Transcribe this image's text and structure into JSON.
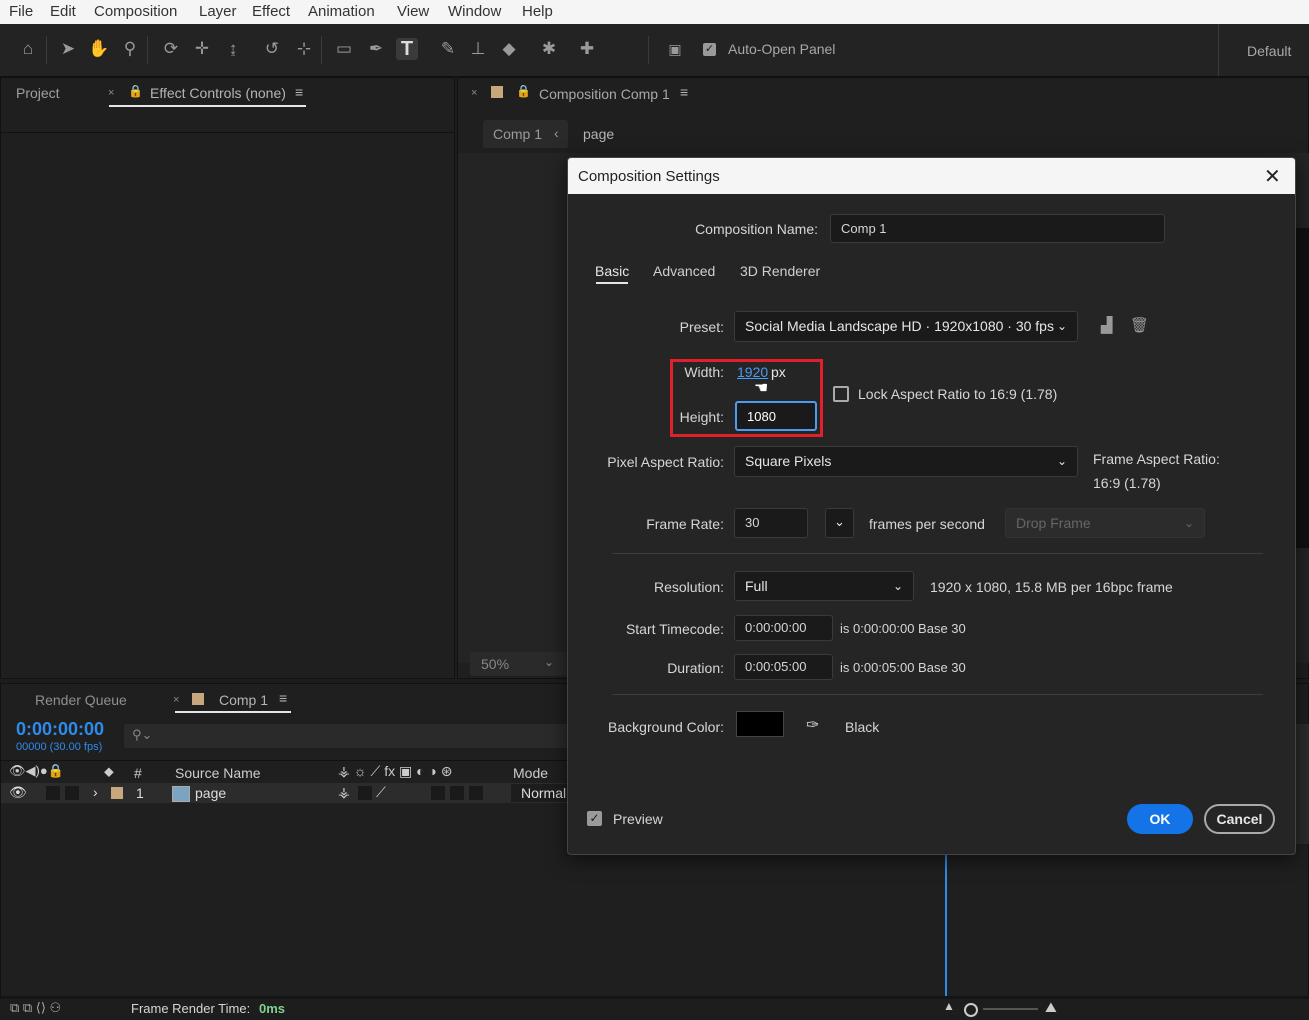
{
  "menu": [
    "File",
    "Edit",
    "Composition",
    "Layer",
    "Effect",
    "Animation",
    "View",
    "Window",
    "Help"
  ],
  "toolbar": {
    "auto_open_label": "Auto-Open Panel",
    "workspace": "Default"
  },
  "left_panel": {
    "tab_project": "Project",
    "tab_effect_controls": "Effect Controls (none)"
  },
  "comp_panel": {
    "tab_title": "Composition Comp 1",
    "breadcrumb_comp": "Comp 1",
    "breadcrumb_page": "page",
    "zoom": "50%"
  },
  "timeline": {
    "tab_render_queue": "Render Queue",
    "tab_comp": "Comp 1",
    "timecode": "0:00:00:00",
    "timecode_sub": "00000 (30.00 fps)",
    "col_number": "#",
    "col_source_name": "Source Name",
    "col_mode": "Mode",
    "layer": {
      "index": "1",
      "name": "page",
      "mode": "Normal"
    },
    "frame_render_label": "Frame Render Time:",
    "frame_render_value": "0ms"
  },
  "dialog": {
    "title": "Composition Settings",
    "comp_name_label": "Composition Name:",
    "comp_name_value": "Comp 1",
    "tabs": [
      "Basic",
      "Advanced",
      "3D Renderer"
    ],
    "preset_label": "Preset:",
    "preset_value": "Social Media Landscape HD · 1920x1080 · 30 fps",
    "width_label": "Width:",
    "width_value": "1920",
    "width_unit": "px",
    "height_label": "Height:",
    "height_value": "1080",
    "lock_aspect_label": "Lock Aspect Ratio to 16:9 (1.78)",
    "par_label": "Pixel Aspect Ratio:",
    "par_value": "Square Pixels",
    "frame_aspect_label": "Frame Aspect Ratio:",
    "frame_aspect_value": "16:9 (1.78)",
    "frame_rate_label": "Frame Rate:",
    "frame_rate_value": "30",
    "fps_label": "frames per second",
    "drop_frame": "Drop Frame",
    "resolution_label": "Resolution:",
    "resolution_value": "Full",
    "resolution_info": "1920 x 1080, 15.8 MB per 16bpc frame",
    "start_tc_label": "Start Timecode:",
    "start_tc_value": "0:00:00:00",
    "start_tc_info": "is 0:00:00:00  Base 30",
    "duration_label": "Duration:",
    "duration_value": "0:00:05:00",
    "duration_info": "is 0:00:05:00  Base 30",
    "bg_color_label": "Background Color:",
    "bg_color_name": "Black",
    "preview_label": "Preview",
    "ok_label": "OK",
    "cancel_label": "Cancel"
  },
  "colors": {
    "accent_blue": "#1473e6",
    "highlight_red": "#e0202a",
    "timecode_blue": "#2d8ceb",
    "label_tan": "#c9a77c"
  }
}
